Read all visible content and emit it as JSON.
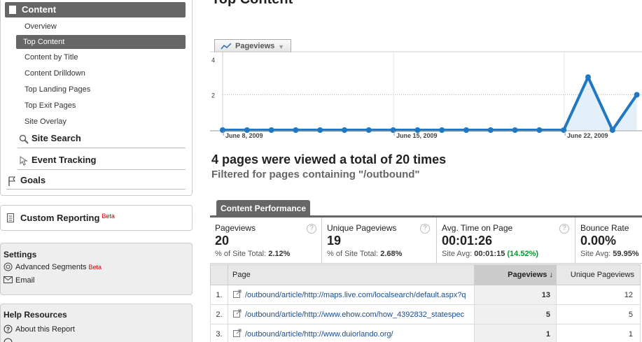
{
  "sidebar": {
    "content_header": "Content",
    "content_items": [
      {
        "label": "Overview"
      },
      {
        "label": "Top Content"
      },
      {
        "label": "Content by Title"
      },
      {
        "label": "Content Drilldown"
      },
      {
        "label": "Top Landing Pages"
      },
      {
        "label": "Top Exit Pages"
      },
      {
        "label": "Site Overlay"
      }
    ],
    "site_search": "Site Search",
    "event_tracking": "Event Tracking",
    "goals": "Goals",
    "custom_reporting": "Custom Reporting",
    "custom_reporting_badge": "Beta",
    "settings_title": "Settings",
    "advanced_segments": "Advanced Segments",
    "advanced_segments_badge": "Beta",
    "email": "Email",
    "help_title": "Help Resources",
    "about_report": "About this Report"
  },
  "main": {
    "title": "Top Content",
    "metric_selector": "Pageviews",
    "summary_title": "4 pages were viewed a total of 20 times",
    "summary_filter": "Filtered for pages containing \"/outbound\"",
    "performance_tab": "Content Performance"
  },
  "scorecard": [
    {
      "label": "Pageviews",
      "value": "20",
      "sub_label": "% of Site Total:",
      "sub_value": "2.12%",
      "sub_extra": ""
    },
    {
      "label": "Unique Pageviews",
      "value": "19",
      "sub_label": "% of Site Total:",
      "sub_value": "2.68%",
      "sub_extra": ""
    },
    {
      "label": "Avg. Time on Page",
      "value": "00:01:26",
      "sub_label": "Site Avg:",
      "sub_value": "00:01:15",
      "sub_extra": "(14.52%)"
    },
    {
      "label": "Bounce Rate",
      "value": "0.00%",
      "sub_label": "Site Avg:",
      "sub_value": "59.95%",
      "sub_extra": ""
    }
  ],
  "table": {
    "columns": [
      "Page",
      "Pageviews",
      "Unique Pageviews"
    ],
    "sort_indicator": "↓",
    "rows": [
      {
        "index": "1.",
        "page": "/outbound/article/http://maps.live.com/localsearch/default.aspx?q=",
        "pageviews": "13",
        "unique": "12"
      },
      {
        "index": "2.",
        "page": "/outbound/article/http://www.ehow.com/how_4392832_statespec",
        "pageviews": "5",
        "unique": "5"
      },
      {
        "index": "3.",
        "page": "/outbound/article/http://www.duiorlando.org/",
        "pageviews": "1",
        "unique": "1"
      }
    ]
  },
  "chart_data": {
    "type": "area",
    "series": [
      {
        "name": "Pageviews",
        "values": [
          0,
          0,
          0,
          0,
          0,
          0,
          0,
          0,
          0,
          0,
          0,
          0,
          0,
          0,
          0,
          0,
          0,
          0,
          0,
          0,
          0,
          0,
          0,
          0,
          0,
          0,
          0,
          0,
          0,
          0,
          0,
          0,
          0,
          0,
          0,
          0,
          0,
          0,
          0,
          0,
          0,
          0,
          0,
          0,
          0,
          0,
          0,
          0,
          0,
          0,
          0,
          0,
          0,
          0,
          0,
          0,
          0,
          0,
          0,
          0,
          0,
          0,
          0,
          0,
          0,
          0,
          0,
          0,
          0,
          0,
          0,
          0,
          0,
          0,
          0,
          0,
          0,
          0,
          0,
          0,
          0,
          0,
          0,
          0,
          0,
          0,
          0,
          0,
          0,
          0,
          0,
          0,
          0,
          0,
          0,
          0,
          0,
          0,
          3,
          0,
          2
        ]
      }
    ],
    "points": [
      0,
      0,
      0,
      0,
      0,
      0,
      0,
      0,
      0,
      0,
      0,
      0,
      0,
      0,
      0,
      3,
      0,
      2
    ],
    "x_tick_labels": [
      "June 8, 2009",
      "June 15, 2009",
      "June 22, 2009"
    ],
    "y_tick_labels": [
      "4",
      "2"
    ],
    "ylim": [
      0,
      4
    ],
    "grid": true,
    "colors": {
      "line": "#1f78c1",
      "fill": "#e3f0fa"
    }
  }
}
